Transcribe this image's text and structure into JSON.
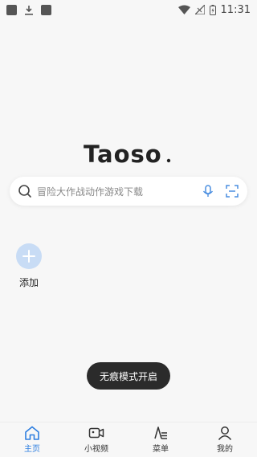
{
  "status_bar": {
    "time": "11:31",
    "icons": [
      "app-notification-icon",
      "download-icon",
      "app-notification-icon",
      "wifi-icon",
      "no-signal-icon",
      "battery-charging-icon"
    ]
  },
  "logo": {
    "text": "Taoso"
  },
  "search": {
    "placeholder": "冒险大作战动作游戏下载"
  },
  "quick_add": {
    "label": "添加"
  },
  "toast": {
    "text": "无痕模式开启"
  },
  "bottom_nav": {
    "items": [
      {
        "label": "主页",
        "icon": "home-icon",
        "active": true
      },
      {
        "label": "小视频",
        "icon": "video-icon",
        "active": false
      },
      {
        "label": "菜单",
        "icon": "menu-icon",
        "active": false
      },
      {
        "label": "我的",
        "icon": "profile-icon",
        "active": false
      }
    ]
  },
  "colors": {
    "accent": "#2f7fe0",
    "add_circle": "#c8dcf5",
    "toast_bg": "#2b2b2b",
    "background": "#f7f7f7"
  }
}
